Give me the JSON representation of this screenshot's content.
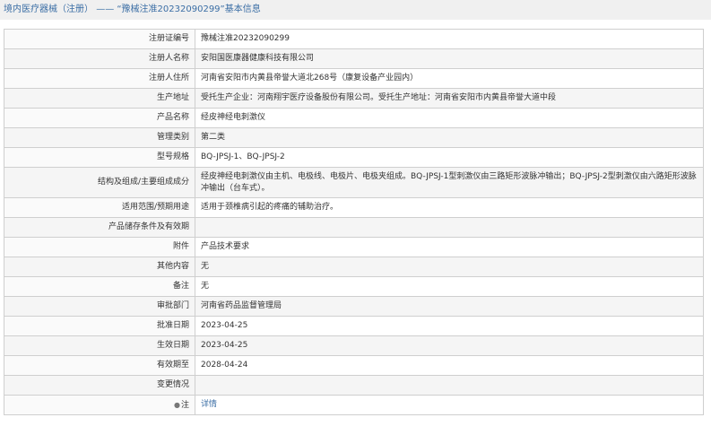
{
  "header": {
    "category": "境内医疗器械（注册）",
    "separator": "——",
    "title": "“豫械注准20232090299”基本信息"
  },
  "rows": [
    {
      "label": "注册证编号",
      "value": "豫械注准20232090299"
    },
    {
      "label": "注册人名称",
      "value": "安阳国医康器健康科技有限公司"
    },
    {
      "label": "注册人住所",
      "value": "河南省安阳市内黄县帝誉大道北268号（康复设备产业园内）"
    },
    {
      "label": "生产地址",
      "value": "受托生产企业：河南翔宇医疗设备股份有限公司。受托生产地址：河南省安阳市内黄县帝誉大道中段"
    },
    {
      "label": "产品名称",
      "value": "经皮神经电刺激仪"
    },
    {
      "label": "管理类别",
      "value": "第二类"
    },
    {
      "label": "型号规格",
      "value": "BQ-JPSJ-1、BQ-JPSJ-2"
    },
    {
      "label": "结构及组成/主要组成成分",
      "value": "经皮神经电刺激仪由主机、电极线、电极片、电极夹组成。BQ-JPSJ-1型刺激仪由三路矩形波脉冲输出；BQ-JPSJ-2型刺激仪由六路矩形波脉冲输出（台车式）。"
    },
    {
      "label": "适用范围/预期用途",
      "value": "适用于颈椎病引起的疼痛的辅助治疗。"
    },
    {
      "label": "产品储存条件及有效期",
      "value": ""
    },
    {
      "label": "附件",
      "value": "产品技术要求"
    },
    {
      "label": "其他内容",
      "value": "无"
    },
    {
      "label": "备注",
      "value": "无"
    },
    {
      "label": "审批部门",
      "value": "河南省药品监督管理局"
    },
    {
      "label": "批准日期",
      "value": "2023-04-25"
    },
    {
      "label": "生效日期",
      "value": "2023-04-25"
    },
    {
      "label": "有效期至",
      "value": "2028-04-24"
    },
    {
      "label": "变更情况",
      "value": ""
    }
  ],
  "note": {
    "label": "注",
    "link": "详情"
  }
}
